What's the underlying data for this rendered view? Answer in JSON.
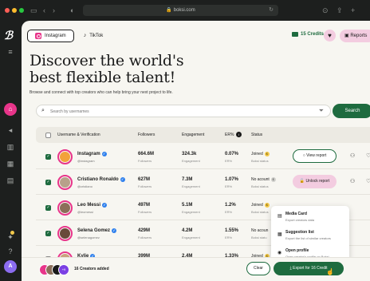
{
  "browser": {
    "url": "boksi.com",
    "traffic_colors": [
      "#ff5f57",
      "#febc2e",
      "#28c840"
    ]
  },
  "rail": {
    "logo": "ℬ",
    "avatar_initial": "A",
    "home_color": "#e8358a"
  },
  "tabs": [
    {
      "label": "Instagram",
      "icon": "instagram-icon",
      "active": true
    },
    {
      "label": "TikTok",
      "icon": "tiktok-icon",
      "active": false
    }
  ],
  "header": {
    "credits": "15 Credits",
    "reports_label": "Reports",
    "headline_line1": "Discover the world's",
    "headline_line2": "best flexible talent!",
    "subline": "Browse and connect with top creators who can help bring your next project to life."
  },
  "search": {
    "placeholder": "Search by usernames",
    "button_label": "Search"
  },
  "table": {
    "columns": [
      "Username & Verification",
      "Followers",
      "Engagement",
      "ER%",
      "Status"
    ],
    "rows": [
      {
        "name": "Instagram",
        "handle": "@instagram",
        "followers": "664.6M",
        "followers_sub": "Followers",
        "engagement": "324.3k",
        "engagement_sub": "Engagement",
        "er": "0.07%",
        "er_sub": "ER%",
        "status": "Joined",
        "status_sub": "Boksi status",
        "status_coin": "gold",
        "checked": true,
        "action": "View report",
        "avatar_color": "#f2a23a"
      },
      {
        "name": "Cristiano Ronaldo",
        "handle": "@cristiano",
        "followers": "627M",
        "followers_sub": "Followers",
        "engagement": "7.3M",
        "engagement_sub": "Engagement",
        "er": "1.07%",
        "er_sub": "ER%",
        "status": "No acount",
        "status_sub": "Boksi status",
        "status_coin": "grey",
        "checked": true,
        "action": "Unlock report",
        "avatar_color": "#b7a18a"
      },
      {
        "name": "Leo Messi",
        "handle": "@leomessi",
        "followers": "497M",
        "followers_sub": "Followers",
        "engagement": "5.1M",
        "engagement_sub": "Engagement",
        "er": "1.2%",
        "er_sub": "ER%",
        "status": "Joined",
        "status_sub": "Boksi status",
        "status_coin": "gold",
        "checked": true,
        "action": "",
        "avatar_color": "#8b6f5a"
      },
      {
        "name": "Selena Gomez",
        "handle": "@selenagomez",
        "followers": "429M",
        "followers_sub": "Followers",
        "engagement": "4.2M",
        "engagement_sub": "Engagement",
        "er": "1.55%",
        "er_sub": "ER%",
        "status": "No acoun",
        "status_sub": "Boksi statu",
        "status_coin": "",
        "checked": true,
        "action": "",
        "avatar_color": "#6a4a3a"
      },
      {
        "name": "Kylie",
        "handle": "",
        "followers": "399M",
        "followers_sub": "",
        "engagement": "2.4M",
        "engagement_sub": "",
        "er": "1.33%",
        "er_sub": "",
        "status": "Joined",
        "status_sub": "",
        "status_coin": "gold",
        "checked": false,
        "action": "",
        "avatar_color": "#c9a27e"
      }
    ]
  },
  "menu": {
    "items": [
      {
        "title": "Media Card",
        "sub": "Export creators data",
        "icon": "document-icon"
      },
      {
        "title": "Suggestion list",
        "sub": "Export the list of similar creators",
        "icon": "list-icon"
      },
      {
        "title": "Open profile",
        "sub": "Open creator's profile on Boksi",
        "icon": "profile-icon"
      }
    ]
  },
  "footer": {
    "more_count": "+9",
    "added_label": "16 Creators added",
    "clear_label": "Clear",
    "export_label": "Export for 16 Credit"
  },
  "colors": {
    "accent_green": "#1e6b3f",
    "accent_pink": "#e8358a",
    "soft_pink": "#f3cce0",
    "panel_bg": "#f7f6f1"
  }
}
